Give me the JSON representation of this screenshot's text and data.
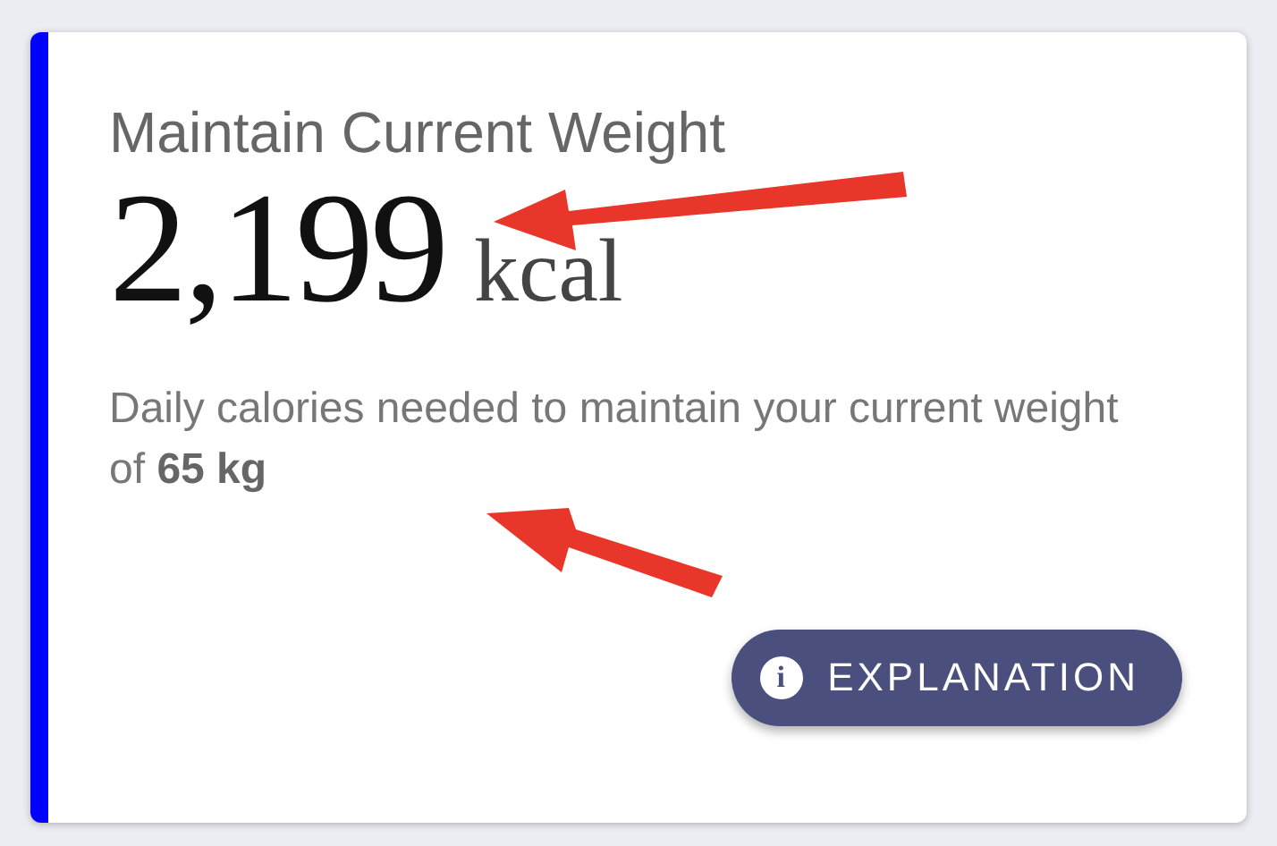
{
  "card": {
    "title": "Maintain Current Weight",
    "value": "2,199",
    "unit": "kcal",
    "description": "Daily calories needed to maintain your current weight of **65 kg**",
    "button": {
      "icon": "i",
      "label": "EXPLANATION"
    }
  }
}
